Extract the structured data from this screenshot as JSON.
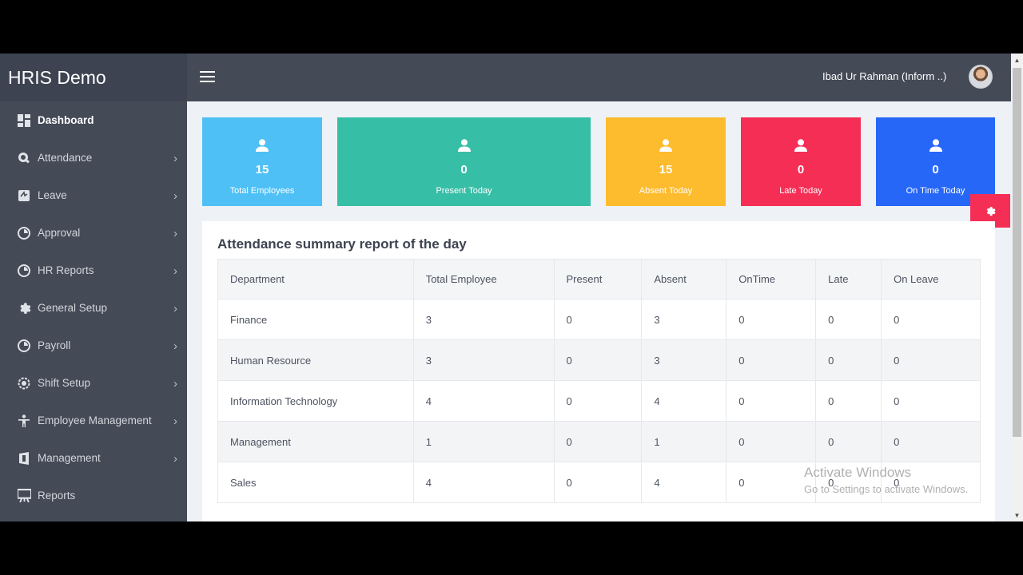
{
  "app": {
    "brand": "HRIS Demo"
  },
  "header": {
    "user_name": "Ibad Ur Rahman (Inform ..)"
  },
  "sidebar": {
    "items": [
      {
        "label": "Dashboard",
        "icon": "dashboard-icon",
        "has_submenu": false,
        "active": true
      },
      {
        "label": "Attendance",
        "icon": "attendance-icon",
        "has_submenu": true
      },
      {
        "label": "Leave",
        "icon": "leave-icon",
        "has_submenu": true
      },
      {
        "label": "Approval",
        "icon": "approval-icon",
        "has_submenu": true
      },
      {
        "label": "HR Reports",
        "icon": "hr-reports-icon",
        "has_submenu": true
      },
      {
        "label": "General Setup",
        "icon": "gear-icon",
        "has_submenu": true
      },
      {
        "label": "Payroll",
        "icon": "payroll-icon",
        "has_submenu": true
      },
      {
        "label": "Shift Setup",
        "icon": "shift-icon",
        "has_submenu": true
      },
      {
        "label": "Employee Management",
        "icon": "person-icon",
        "has_submenu": true
      },
      {
        "label": "Management",
        "icon": "management-icon",
        "has_submenu": true
      },
      {
        "label": "Reports",
        "icon": "reports-icon",
        "has_submenu": false
      }
    ]
  },
  "cards": [
    {
      "value": "15",
      "label": "Total Employees",
      "color": "#4ec0f5"
    },
    {
      "value": "0",
      "label": "Present Today",
      "color": "#37bea6"
    },
    {
      "value": "15",
      "label": "Absent Today",
      "color": "#fdbb2e"
    },
    {
      "value": "0",
      "label": "Late Today",
      "color": "#f52e56"
    },
    {
      "value": "0",
      "label": "On Time Today",
      "color": "#2767f8"
    }
  ],
  "report": {
    "title": "Attendance summary report of the day",
    "columns": [
      "Department",
      "Total Employee",
      "Present",
      "Absent",
      "OnTime",
      "Late",
      "On Leave"
    ],
    "rows": [
      [
        "Finance",
        "3",
        "0",
        "3",
        "0",
        "0",
        "0"
      ],
      [
        "Human Resource",
        "3",
        "0",
        "3",
        "0",
        "0",
        "0"
      ],
      [
        "Information Technology",
        "4",
        "0",
        "4",
        "0",
        "0",
        "0"
      ],
      [
        "Management",
        "1",
        "0",
        "1",
        "0",
        "0",
        "0"
      ],
      [
        "Sales",
        "4",
        "0",
        "4",
        "0",
        "0",
        "0"
      ]
    ]
  },
  "watermark": {
    "line1": "Activate Windows",
    "line2": "Go to Settings to activate Windows."
  }
}
